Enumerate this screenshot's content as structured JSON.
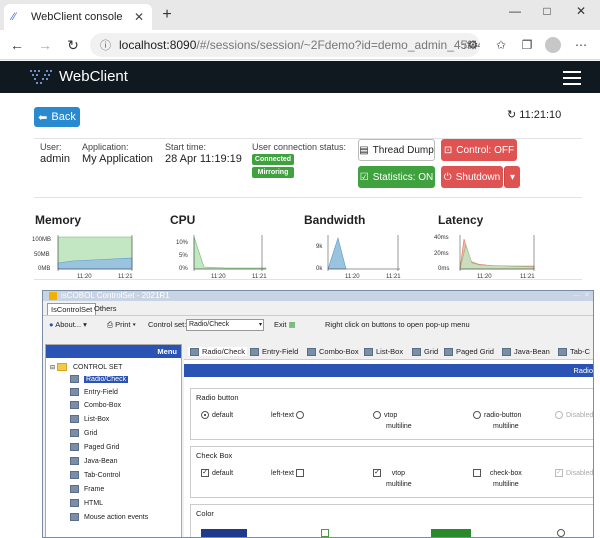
{
  "browser": {
    "tab_title": "WebClient console",
    "tab_close": "✕",
    "new_tab": "+",
    "url_host": "localhost:8090",
    "url_path": "/#/sessions/session/~2Fdemo?id=demo_admin_45f445722...",
    "window_controls": [
      "—",
      "□",
      "✕"
    ]
  },
  "app": {
    "brand": "WebClient"
  },
  "session": {
    "back_label": "Back",
    "time": "11:21:10",
    "user_label": "User:",
    "user_value": "admin",
    "application_label": "Application:",
    "application_value": "My Application",
    "start_label": "Start time:",
    "start_value": "28 Apr 11:19:19",
    "status_label": "User connection status:",
    "status_connected": "Connected",
    "status_mirroring": "Mirroring"
  },
  "actions": {
    "thread_dump": "Thread Dump",
    "control": "Control: OFF",
    "statistics": "Statistics: ON",
    "shutdown": "Shutdown"
  },
  "colors": {
    "primary": "#2a8ad0",
    "danger": "#e05353",
    "success": "#3fa23f",
    "header": "#101820",
    "nav": "#2b53b4"
  },
  "metrics": [
    {
      "title": "Memory",
      "yticks": [
        "100MB",
        "50MB",
        "0MB"
      ],
      "xticks": [
        "11:20",
        "11:21"
      ]
    },
    {
      "title": "CPU",
      "yticks": [
        "10%",
        "5%",
        "0%"
      ],
      "xticks": [
        "11:20",
        "11:21"
      ]
    },
    {
      "title": "Bandwidth",
      "yticks": [
        "9k",
        "0k"
      ],
      "xticks": [
        "11:20",
        "11:21"
      ]
    },
    {
      "title": "Latency",
      "yticks": [
        "40ms",
        "20ms",
        "0ms"
      ],
      "xticks": [
        "11:20",
        "11:21"
      ]
    }
  ],
  "controlset": {
    "title": "isCOBOL ControlSet - 2021R1",
    "tabs": [
      "IsControlSet",
      "Others"
    ],
    "toolbar": {
      "about": "About...",
      "print": "Print",
      "control_set_label": "Control set:",
      "control_set_value": "Radio/Check",
      "exit": "Exit",
      "hint": "Right click on buttons to open pop-up menu"
    },
    "menu_title": "Menu",
    "tree_root": "CONTROL SET",
    "tree_items": [
      "Radio/Check",
      "Entry-Field",
      "Combo-Box",
      "List-Box",
      "Grid",
      "Paged Grid",
      "Java-Bean",
      "Tab-Control",
      "Frame",
      "HTML",
      "Mouse action events"
    ],
    "right_tabs": [
      "Radio/Check",
      "Entry-Field",
      "Combo-Box",
      "List-Box",
      "Grid",
      "Paged Grid",
      "Java-Bean",
      "Tab-C"
    ],
    "right_bar": "Radio",
    "radio_group": {
      "label": "Radio button",
      "opts": [
        "default",
        "left-text",
        "vtop",
        "radio-button",
        "Disabled"
      ],
      "subs": [
        "multiline",
        "multiline"
      ]
    },
    "check_group": {
      "label": "Check Box",
      "opts": [
        "default",
        "left-text",
        "vtop",
        "check-box",
        "Disabled"
      ],
      "subs": [
        "multiline",
        "multiline"
      ]
    },
    "color_group": {
      "label": "Color"
    }
  }
}
